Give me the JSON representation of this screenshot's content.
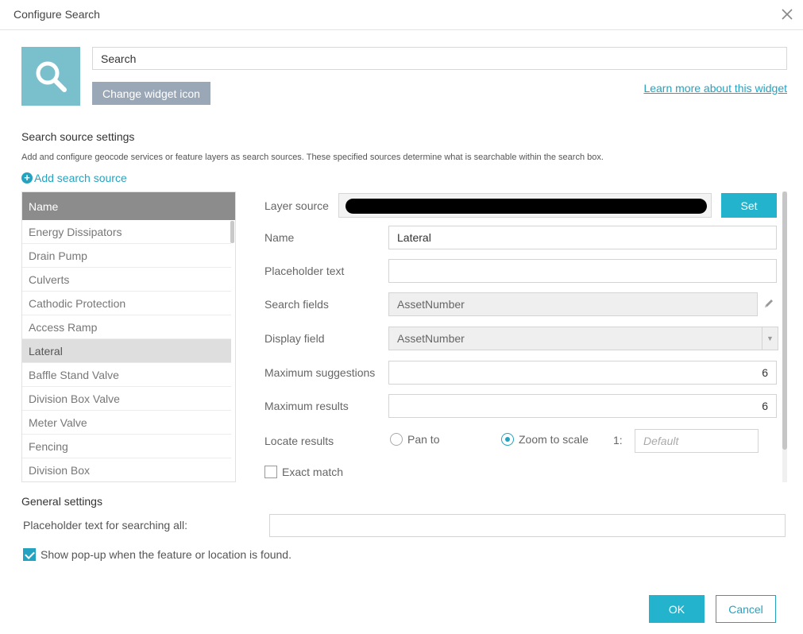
{
  "dialog": {
    "title": "Configure Search",
    "close_icon": "close-icon"
  },
  "widget": {
    "icon": "search-icon",
    "icon_bg": "#7ac0cc",
    "label_value": "Search",
    "change_icon_label": "Change widget icon",
    "learn_more_label": "Learn more about this widget"
  },
  "search_sources": {
    "title": "Search source settings",
    "description": "Add and configure geocode services or feature layers as search sources. These specified sources determine what is searchable within the search box.",
    "add_label": "Add search source",
    "list_header": "Name",
    "items": [
      "Energy Dissipators",
      "Drain Pump",
      "Culverts",
      "Cathodic Protection",
      "Access Ramp",
      "Lateral",
      "Baffle Stand Valve",
      "Division Box Valve",
      "Meter Valve",
      "Fencing",
      "Division Box"
    ],
    "selected": "Lateral"
  },
  "source_form": {
    "layer_source_label": "Layer source",
    "set_label": "Set",
    "name_label": "Name",
    "name_value": "Lateral",
    "placeholder_label": "Placeholder text",
    "placeholder_value": "",
    "search_fields_label": "Search fields",
    "search_fields_value": "AssetNumber",
    "display_field_label": "Display field",
    "display_field_value": "AssetNumber",
    "max_suggestions_label": "Maximum suggestions",
    "max_suggestions_value": "6",
    "max_results_label": "Maximum results",
    "max_results_value": "6",
    "locate_results_label": "Locate results",
    "pan_to_label": "Pan to",
    "zoom_to_scale_label": "Zoom to scale",
    "locate_selected": "Zoom to scale",
    "scale_prefix": "1:",
    "scale_placeholder": "Default",
    "exact_match_label": "Exact match",
    "exact_match_checked": false
  },
  "general": {
    "title": "General settings",
    "placeholder_all_label": "Placeholder text for searching all:",
    "placeholder_all_value": "",
    "show_popup_label": "Show pop-up when the feature or location is found.",
    "show_popup_checked": true
  },
  "footer": {
    "ok_label": "OK",
    "cancel_label": "Cancel"
  },
  "colors": {
    "accent": "#24a3c0",
    "button_primary": "#24b3cc",
    "button_secondary": "#9aa7b7",
    "list_header": "#8c8c8c"
  }
}
